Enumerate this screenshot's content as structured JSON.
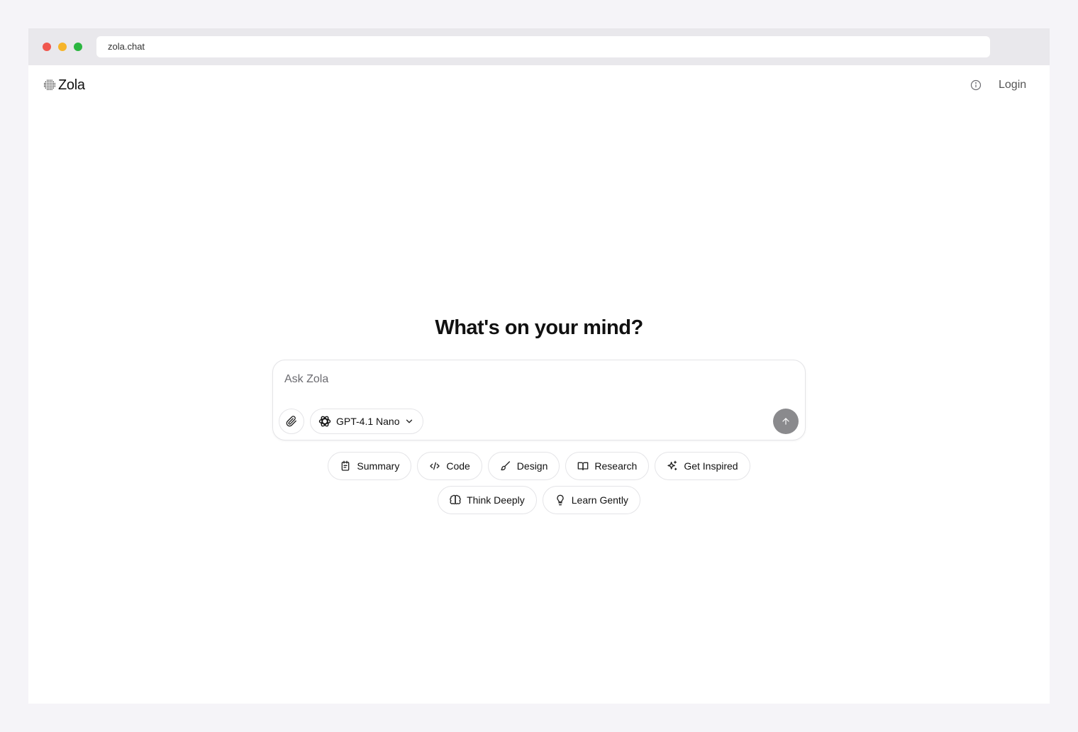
{
  "browser": {
    "url": "zola.chat"
  },
  "header": {
    "logo_text": "Zola",
    "info_icon": "info-icon",
    "login_label": "Login"
  },
  "main": {
    "heading": "What's on your mind?",
    "composer": {
      "placeholder": "Ask Zola",
      "value": "",
      "attach_icon": "paperclip-icon",
      "model_icon": "openai-icon",
      "model_label": "GPT-4.1 Nano",
      "model_chevron_icon": "chevron-down-icon",
      "send_icon": "arrow-up-icon",
      "send_color": "#8a8a8d"
    },
    "suggestions": [
      {
        "label": "Summary",
        "icon": "notepad-icon"
      },
      {
        "label": "Code",
        "icon": "code-icon"
      },
      {
        "label": "Design",
        "icon": "brush-icon"
      },
      {
        "label": "Research",
        "icon": "book-icon"
      },
      {
        "label": "Get Inspired",
        "icon": "sparkle-icon"
      },
      {
        "label": "Think Deeply",
        "icon": "brain-icon"
      },
      {
        "label": "Learn Gently",
        "icon": "lightbulb-icon"
      }
    ]
  },
  "colors": {
    "window_dot_red": "#f0574e",
    "window_dot_yellow": "#f6b42a",
    "window_dot_green": "#2bb640"
  }
}
